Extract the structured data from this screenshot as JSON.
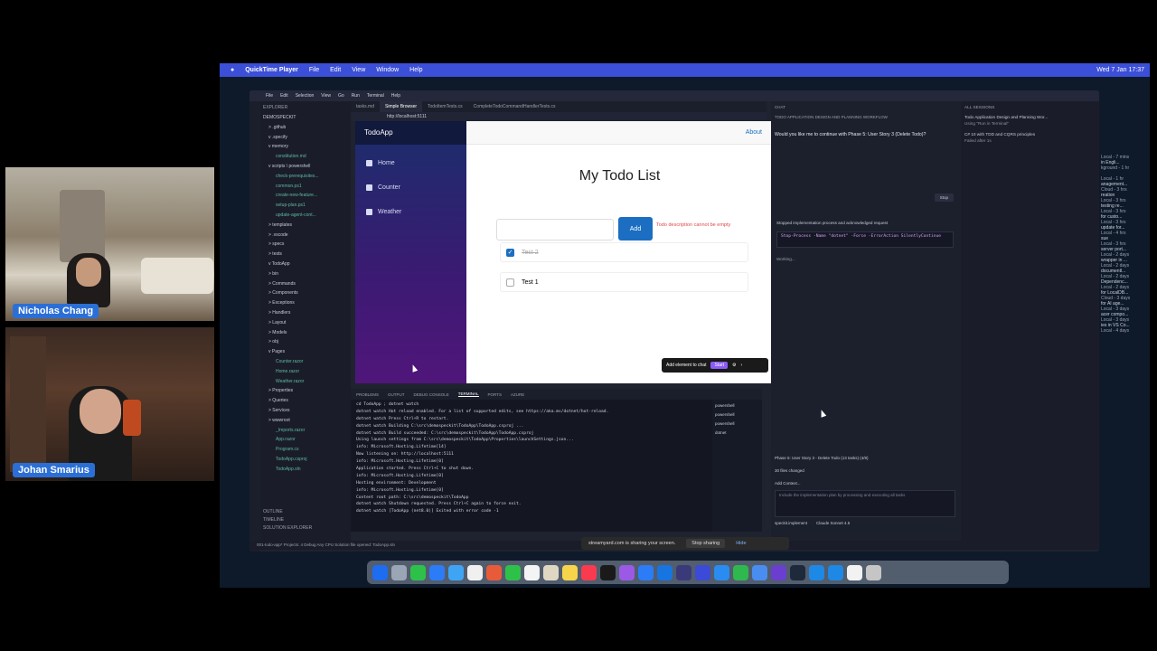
{
  "participants": [
    {
      "name": "Nicholas Chang"
    },
    {
      "name": "Johan Smarius"
    }
  ],
  "menubar": {
    "app": "QuickTime Player",
    "items": [
      "File",
      "Edit",
      "View",
      "Window",
      "Help"
    ],
    "clock": "Wed 7 Jan 17:37"
  },
  "vscode": {
    "menu": [
      "File",
      "Edit",
      "Selection",
      "View",
      "Go",
      "Run",
      "Terminal",
      "Help"
    ],
    "explorer_title": "EXPLORER",
    "tree": [
      {
        "t": "DEMOSPECKIT",
        "k": "folder"
      },
      {
        "t": "> .github",
        "k": "folder"
      },
      {
        "t": "v .specify",
        "k": "folder"
      },
      {
        "t": "v memory",
        "k": "folder"
      },
      {
        "t": "constitution.md",
        "k": "file"
      },
      {
        "t": "v scripts \\ powershell",
        "k": "folder"
      },
      {
        "t": "check-prerequisites...",
        "k": "file"
      },
      {
        "t": "common.ps1",
        "k": "file"
      },
      {
        "t": "create-new-feature...",
        "k": "file"
      },
      {
        "t": "setup-plan.ps1",
        "k": "file"
      },
      {
        "t": "update-agent-cont...",
        "k": "file"
      },
      {
        "t": "> templates",
        "k": "folder"
      },
      {
        "t": "> .vscode",
        "k": "folder"
      },
      {
        "t": "> specs",
        "k": "folder"
      },
      {
        "t": "> tests",
        "k": "folder"
      },
      {
        "t": "v TodoApp",
        "k": "folder"
      },
      {
        "t": "> bin",
        "k": "folder"
      },
      {
        "t": "> Commands",
        "k": "folder"
      },
      {
        "t": "> Components",
        "k": "folder"
      },
      {
        "t": "> Exceptions",
        "k": "folder"
      },
      {
        "t": "> Handlers",
        "k": "folder"
      },
      {
        "t": "> Layout",
        "k": "folder"
      },
      {
        "t": "> Models",
        "k": "folder"
      },
      {
        "t": "> obj",
        "k": "folder"
      },
      {
        "t": "v Pages",
        "k": "folder"
      },
      {
        "t": "Counter.razor",
        "k": "file"
      },
      {
        "t": "Home.razor",
        "k": "file"
      },
      {
        "t": "Weather.razor",
        "k": "file"
      },
      {
        "t": "> Properties",
        "k": "folder"
      },
      {
        "t": "> Queries",
        "k": "folder"
      },
      {
        "t": "> Services",
        "k": "folder"
      },
      {
        "t": "> wwwroot",
        "k": "folder"
      },
      {
        "t": "_Imports.razor",
        "k": "file"
      },
      {
        "t": "App.razor",
        "k": "file"
      },
      {
        "t": "Program.cs",
        "k": "file"
      },
      {
        "t": "TodoApp.csproj",
        "k": "file"
      },
      {
        "t": "TodoApp.sln",
        "k": "file"
      }
    ],
    "outline": [
      "OUTLINE",
      "TIMELINE",
      "SOLUTION EXPLORER"
    ],
    "tabs": [
      "tasks.md",
      "Simple Browser",
      "TodoItemTests.cs",
      "CompleteTodoCommandHandlerTests.cs"
    ],
    "address": "http://localhost:5111",
    "statusbar": "001-todo-app*   Projects: 4   Debug Any CPU   Solution file opened: TodoApp.sln"
  },
  "todo_app": {
    "brand": "TodoApp",
    "nav": [
      "Home",
      "Counter",
      "Weather"
    ],
    "about": "About",
    "title": "My Todo List",
    "add_button": "Add",
    "error": "Todo description cannot be empty",
    "items": [
      {
        "label": "Test 2",
        "done": true
      },
      {
        "label": "Test 1",
        "done": false
      }
    ],
    "add_to_chat": "Add element to chat",
    "start": "Start"
  },
  "terminal": {
    "tabs": [
      "PROBLEMS",
      "OUTPUT",
      "DEBUG CONSOLE",
      "TERMINAL",
      "PORTS",
      "AZURE"
    ],
    "lines": [
      "cd TodoApp ; dotnet watch",
      "dotnet watch  Hot reload enabled. For a list of supported edits, see https://aka.ms/dotnet/hot-reload.",
      "dotnet watch  Press Ctrl+R to restart.",
      "dotnet watch  Building C:\\src\\demospeckit\\TodoApp\\TodoApp.csproj ...",
      "dotnet watch  Build succeeded: C:\\src\\demospeckit\\TodoApp\\TodoApp.csproj",
      "Using launch settings from C:\\src\\demospeckit\\TodoApp\\Properties\\launchSettings.json...",
      "info: Microsoft.Hosting.Lifetime[14]",
      "      Now listening on: http://localhost:5111",
      "info: Microsoft.Hosting.Lifetime[0]",
      "      Application started. Press Ctrl+C to shut down.",
      "info: Microsoft.Hosting.Lifetime[0]",
      "      Hosting environment: Development",
      "info: Microsoft.Hosting.Lifetime[0]",
      "      Content root path: C:\\src\\demospeckit\\TodoApp",
      "dotnet watch  Shutdown requested. Press Ctrl+C again to force exit.",
      "dotnet watch  [TodoApp (net8.0)] Exited with error code -1"
    ],
    "sessions": [
      "powershell",
      "powershell",
      "powershell",
      "dotnet"
    ]
  },
  "chat": {
    "header": "CHAT",
    "title": "TODO APPLICATION DESIGN AND PLANNING WORKFLOW",
    "question": "Would you like me to continue with Phase 5: User Story 3 (Delete Todo)?",
    "stop": "Stop",
    "note": "Stopped implementation process and acknowledged request",
    "command": "Stop-Process -Name \"dotnet\" -Force -ErrorAction SilentlyContinue",
    "working": "Working...",
    "phase": "Phase 5: User Story 3 - Delete Todo (13 tasks) (4/8)",
    "files_changed": "30 files changed",
    "add_context": "Add Context...",
    "input_placeholder": "Include the implementation plan by processing and executing all tasks",
    "agent": "speckit.implement",
    "model": "Claude Sonnet 4.5"
  },
  "sessions": {
    "title": "ALL SESSIONS",
    "items": [
      {
        "title": "Todo Application Design and Planning Wor...",
        "sub": "Using \"Run in Terminal\""
      },
      {
        "title": "C# 10 with TDD and CQRS principles",
        "sub": "Failed after 1s"
      }
    ]
  },
  "right_list": [
    [
      "",
      "Local - 7 mins"
    ],
    [
      "in Engli...",
      "kground - 1 hr"
    ],
    [
      "",
      "Local - 1 hr"
    ],
    [
      "anagement...",
      "Cloud - 3 hrs"
    ],
    [
      "reation",
      "Local - 3 hrs"
    ],
    [
      "testing re...",
      "Local - 3 hrs"
    ],
    [
      "for custo...",
      "Local - 3 hrs"
    ],
    [
      "update for...",
      "Local - 4 hrs"
    ],
    [
      "sue",
      "Local - 3 hrs"
    ],
    [
      "server port...",
      "Local - 2 days"
    ],
    [
      "wrapper in ...",
      "Local - 2 days"
    ],
    [
      "documentl...",
      "Local - 2 days"
    ],
    [
      "Dependenc...",
      "Local - 2 days"
    ],
    [
      "for LocalDB...",
      "Cloud - 3 days"
    ],
    [
      "for AI age...",
      "Local - 3 days"
    ],
    [
      "acer compo...",
      "Local - 3 days"
    ],
    [
      "ies in VS Co...",
      "Local - 4 days"
    ]
  ],
  "share": {
    "text": "streamyard.com is sharing your screen.",
    "stop": "Stop sharing",
    "hide": "Hide"
  },
  "dock_colors": [
    "#1e6cf0",
    "#9aa5b5",
    "#2ec14a",
    "#2b7cf6",
    "#3fa4f4",
    "#f0f0f0",
    "#e85b3a",
    "#2ec14a",
    "#f4f4f4",
    "#e0d7c3",
    "#f7d54b",
    "#fa3b4f",
    "#1a1a1a",
    "#9b59e6",
    "#2b7cf6",
    "#1675e0",
    "#3a3a7a",
    "#3c4ad8",
    "#2a8cf0",
    "#2fb84d",
    "#4a8df0",
    "#6a3fd0",
    "#1e2a3c",
    "#1e88e5",
    "#1e88e5",
    "#f2f2f2",
    "#c5c5c5"
  ]
}
